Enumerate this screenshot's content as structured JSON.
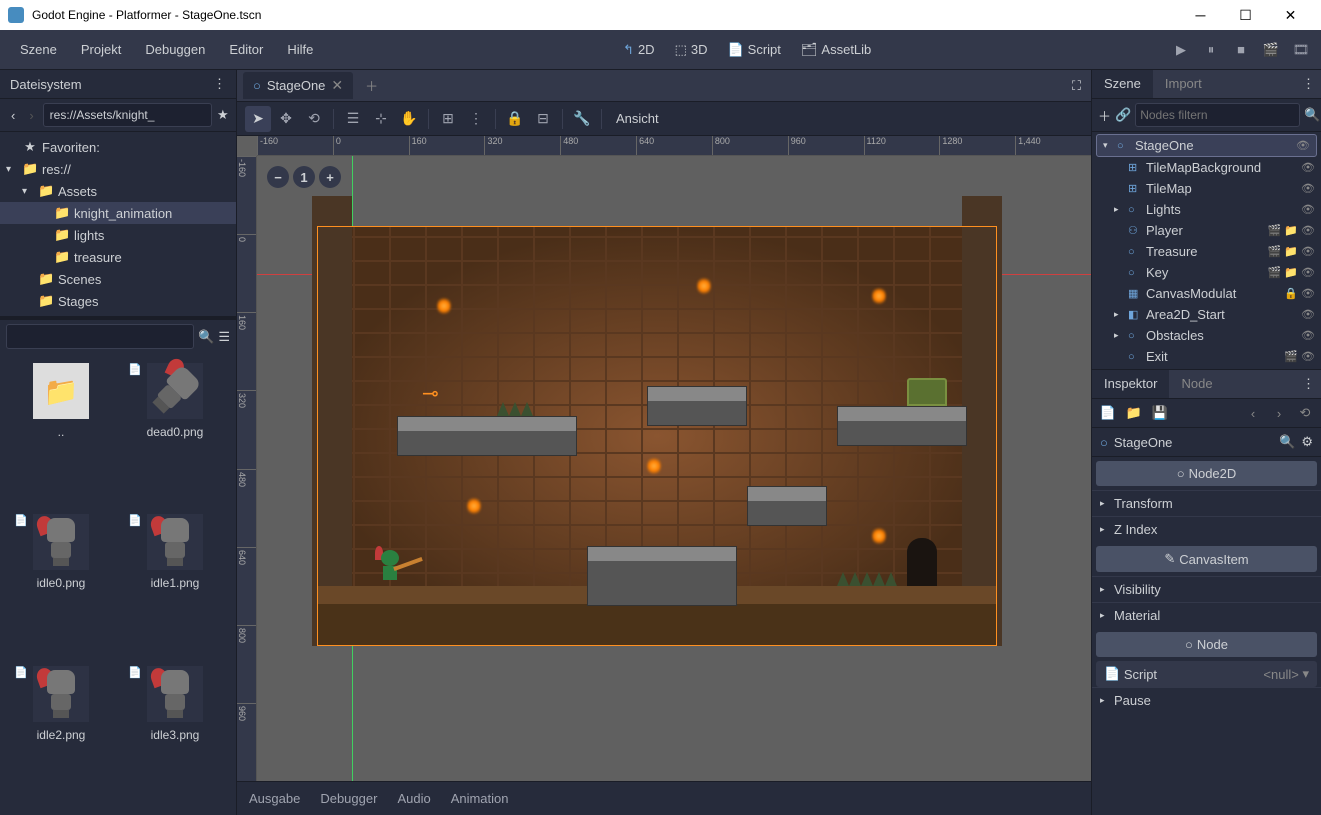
{
  "window": {
    "title": "Godot Engine - Platformer - StageOne.tscn"
  },
  "menubar": {
    "items": [
      "Szene",
      "Projekt",
      "Debuggen",
      "Editor",
      "Hilfe"
    ],
    "modes": {
      "d2": "2D",
      "d3": "3D",
      "script": "Script",
      "asset": "AssetLib"
    }
  },
  "filesystem": {
    "tab": "Dateisystem",
    "path": "res://Assets/knight_",
    "favorites": "Favoriten:",
    "tree": [
      {
        "label": "res://",
        "indent": 0,
        "chev": "▾",
        "icon": "📁"
      },
      {
        "label": "Assets",
        "indent": 1,
        "chev": "▾",
        "icon": "📁"
      },
      {
        "label": "knight_animation",
        "indent": 2,
        "chev": "",
        "icon": "📁",
        "selected": true
      },
      {
        "label": "lights",
        "indent": 2,
        "chev": "",
        "icon": "📁"
      },
      {
        "label": "treasure",
        "indent": 2,
        "chev": "",
        "icon": "📁"
      },
      {
        "label": "Scenes",
        "indent": 1,
        "chev": "",
        "icon": "📁"
      },
      {
        "label": "Stages",
        "indent": 1,
        "chev": "",
        "icon": "📁"
      }
    ],
    "files": [
      "..",
      "dead0.png",
      "idle0.png",
      "idle1.png",
      "idle2.png",
      "idle3.png"
    ]
  },
  "scene_tab": "StageOne",
  "toolbar": {
    "view": "Ansicht"
  },
  "ruler_h": [
    "-160",
    "0",
    "160",
    "320",
    "480",
    "640",
    "800",
    "960",
    "1120",
    "1280",
    "1,440"
  ],
  "ruler_v": [
    "-160",
    "0",
    "160",
    "320",
    "480",
    "640",
    "800",
    "960"
  ],
  "bottom": [
    "Ausgabe",
    "Debugger",
    "Audio",
    "Animation"
  ],
  "scene_panel": {
    "tabs": {
      "scene": "Szene",
      "import": "Import"
    },
    "filter": "Nodes filtern",
    "nodes": [
      {
        "name": "StageOne",
        "icon": "○",
        "indent": 0,
        "chev": "▾",
        "selected": true,
        "vis": true
      },
      {
        "name": "TileMapBackground",
        "icon": "⊞",
        "indent": 1,
        "vis": true
      },
      {
        "name": "TileMap",
        "icon": "⊞",
        "indent": 1,
        "vis": true
      },
      {
        "name": "Lights",
        "icon": "○",
        "indent": 1,
        "chev": "▸",
        "vis": true
      },
      {
        "name": "Player",
        "icon": "⚇",
        "indent": 1,
        "vis": true,
        "extra": "🎬 📁"
      },
      {
        "name": "Treasure",
        "icon": "○",
        "indent": 1,
        "vis": true,
        "extra": "🎬 📁"
      },
      {
        "name": "Key",
        "icon": "○",
        "indent": 1,
        "vis": true,
        "extra": "🎬 📁"
      },
      {
        "name": "CanvasModulat",
        "icon": "▦",
        "indent": 1,
        "vis": true,
        "extra": "🔒"
      },
      {
        "name": "Area2D_Start",
        "icon": "◧",
        "indent": 1,
        "chev": "▸",
        "vis": true
      },
      {
        "name": "Obstacles",
        "icon": "○",
        "indent": 1,
        "chev": "▸",
        "vis": true
      },
      {
        "name": "Exit",
        "icon": "○",
        "indent": 1,
        "vis": true,
        "extra": "🎬"
      }
    ]
  },
  "inspector": {
    "tabs": {
      "insp": "Inspektor",
      "node": "Node"
    },
    "object": "StageOne",
    "sections": [
      "Node2D",
      "CanvasItem",
      "Node"
    ],
    "props": [
      "Transform",
      "Z Index",
      "Visibility",
      "Material",
      "Pause"
    ],
    "script_label": "Script",
    "script_val": "<null>"
  }
}
